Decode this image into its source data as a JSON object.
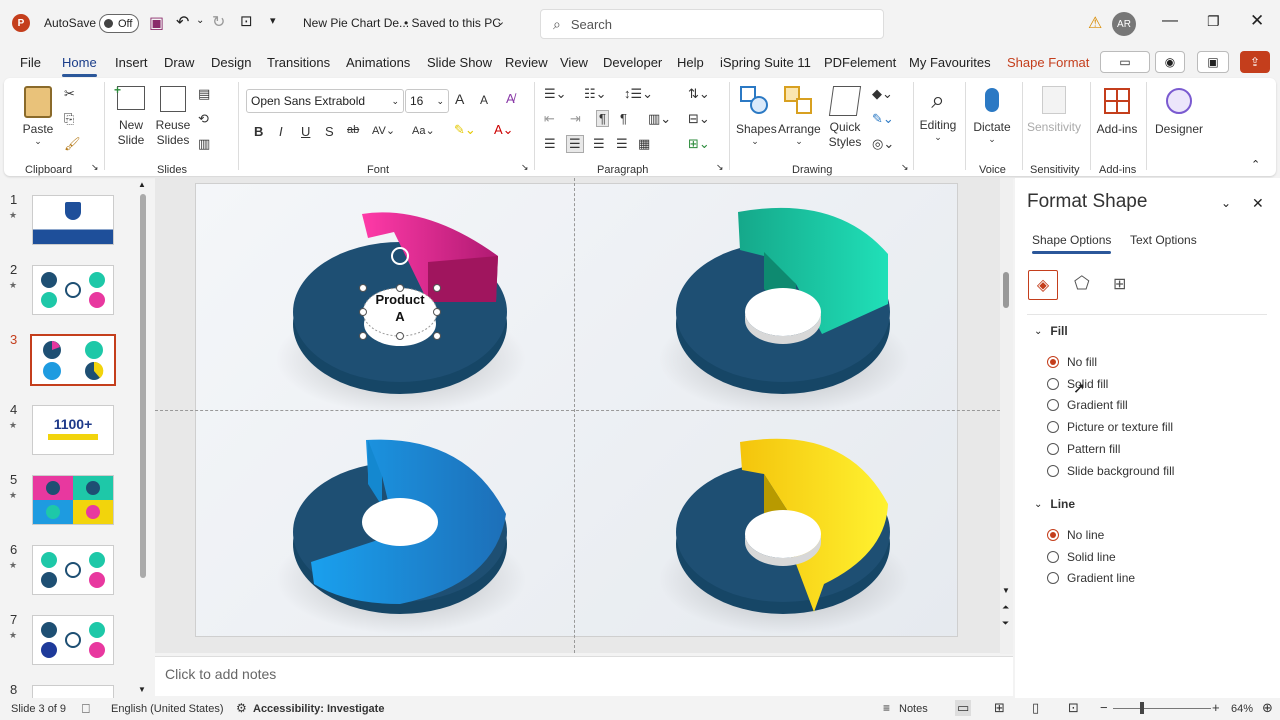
{
  "titlebar": {
    "autosave_label": "AutoSave",
    "autosave_state": "Off",
    "doc_title": "New Pie Chart De...",
    "doc_status": "• Saved to this PC",
    "search_placeholder": "Search",
    "user_initials": "AR"
  },
  "tabs": [
    "File",
    "Home",
    "Insert",
    "Draw",
    "Design",
    "Transitions",
    "Animations",
    "Slide Show",
    "Review",
    "View",
    "Developer",
    "Help",
    "iSpring Suite 11",
    "PDFelement",
    "My Favourites",
    "Shape Format"
  ],
  "ribbon": {
    "paste": "Paste",
    "new_slide": "New Slide",
    "reuse_slides": "Reuse Slides",
    "font_name": "Open Sans Extrabold",
    "font_size": "16",
    "shapes": "Shapes",
    "arrange": "Arrange",
    "quick_styles": "Quick Styles",
    "editing": "Editing",
    "dictate": "Dictate",
    "sensitivity": "Sensitivity",
    "addins": "Add-ins",
    "designer": "Designer",
    "groups": [
      "Clipboard",
      "Slides",
      "Font",
      "Paragraph",
      "Drawing",
      "Voice",
      "Sensitivity",
      "Add-ins"
    ]
  },
  "thumbnails": [
    {
      "num": "1",
      "text": "",
      "star": true
    },
    {
      "num": "2",
      "text": "",
      "star": true
    },
    {
      "num": "3",
      "text": "",
      "star": false
    },
    {
      "num": "4",
      "text": "1100+",
      "star": true
    },
    {
      "num": "5",
      "text": "",
      "star": true
    },
    {
      "num": "6",
      "text": "",
      "star": true
    },
    {
      "num": "7",
      "text": "",
      "star": true
    },
    {
      "num": "8",
      "text": "",
      "star": false
    }
  ],
  "slide": {
    "label_line1": "Product",
    "label_line2": "A",
    "colors": {
      "base": "#1e4f73",
      "pink": "#e8389f",
      "teal": "#1ec8a8",
      "blue": "#1e9be0",
      "yellow": "#f2d40c"
    }
  },
  "notes_placeholder": "Click to add notes",
  "pane": {
    "title": "Format Shape",
    "tab_shape": "Shape Options",
    "tab_text": "Text Options",
    "fill_title": "Fill",
    "fill_options": [
      "No fill",
      "Solid fill",
      "Gradient fill",
      "Picture or texture fill",
      "Pattern fill",
      "Slide background fill"
    ],
    "line_title": "Line",
    "line_options": [
      "No line",
      "Solid line",
      "Gradient line"
    ]
  },
  "status": {
    "slide_info": "Slide 3 of 9",
    "language": "English (United States)",
    "accessibility": "Accessibility: Investigate",
    "notes": "Notes",
    "zoom": "64%"
  }
}
